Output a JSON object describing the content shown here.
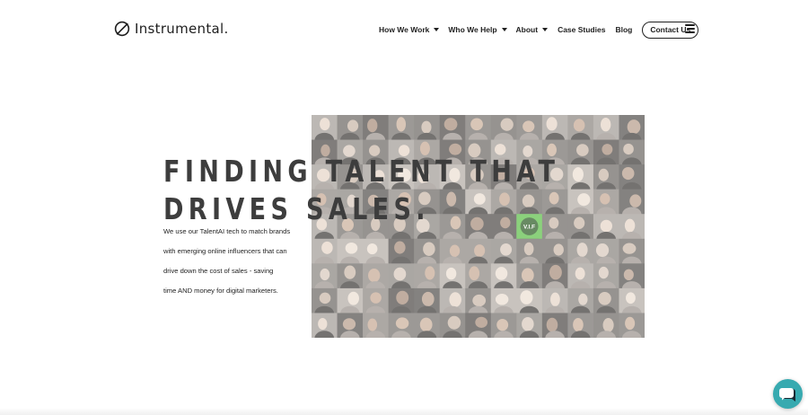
{
  "brand": {
    "name": "Instrumental."
  },
  "nav": {
    "items": [
      {
        "label": "How We Work",
        "dropdown": true
      },
      {
        "label": "Who We Help",
        "dropdown": true
      },
      {
        "label": "About",
        "dropdown": true
      },
      {
        "label": "Case Studies",
        "dropdown": false
      },
      {
        "label": "Blog",
        "dropdown": false
      }
    ],
    "contact_label": "Contact Us",
    "menu_icon": "hamburger-menu-icon"
  },
  "hero": {
    "title_line1": "FINDING TALENT THAT",
    "title_line2": "DRIVES SALES.",
    "desc_lines": [
      "We use our TalentAI tech to match brands",
      "with emerging online influencers that can",
      "drive down the cost of sales - saving",
      "time AND money for digital marketers."
    ],
    "image": "influencer-collage-image",
    "badge": "V.I.F"
  },
  "chat": {
    "icon": "chat-bubble-icon",
    "color": "#37aab0"
  },
  "colors": {
    "accent": "#37aab0",
    "text": "#1f1f1f",
    "title": "#3d3d3d"
  }
}
